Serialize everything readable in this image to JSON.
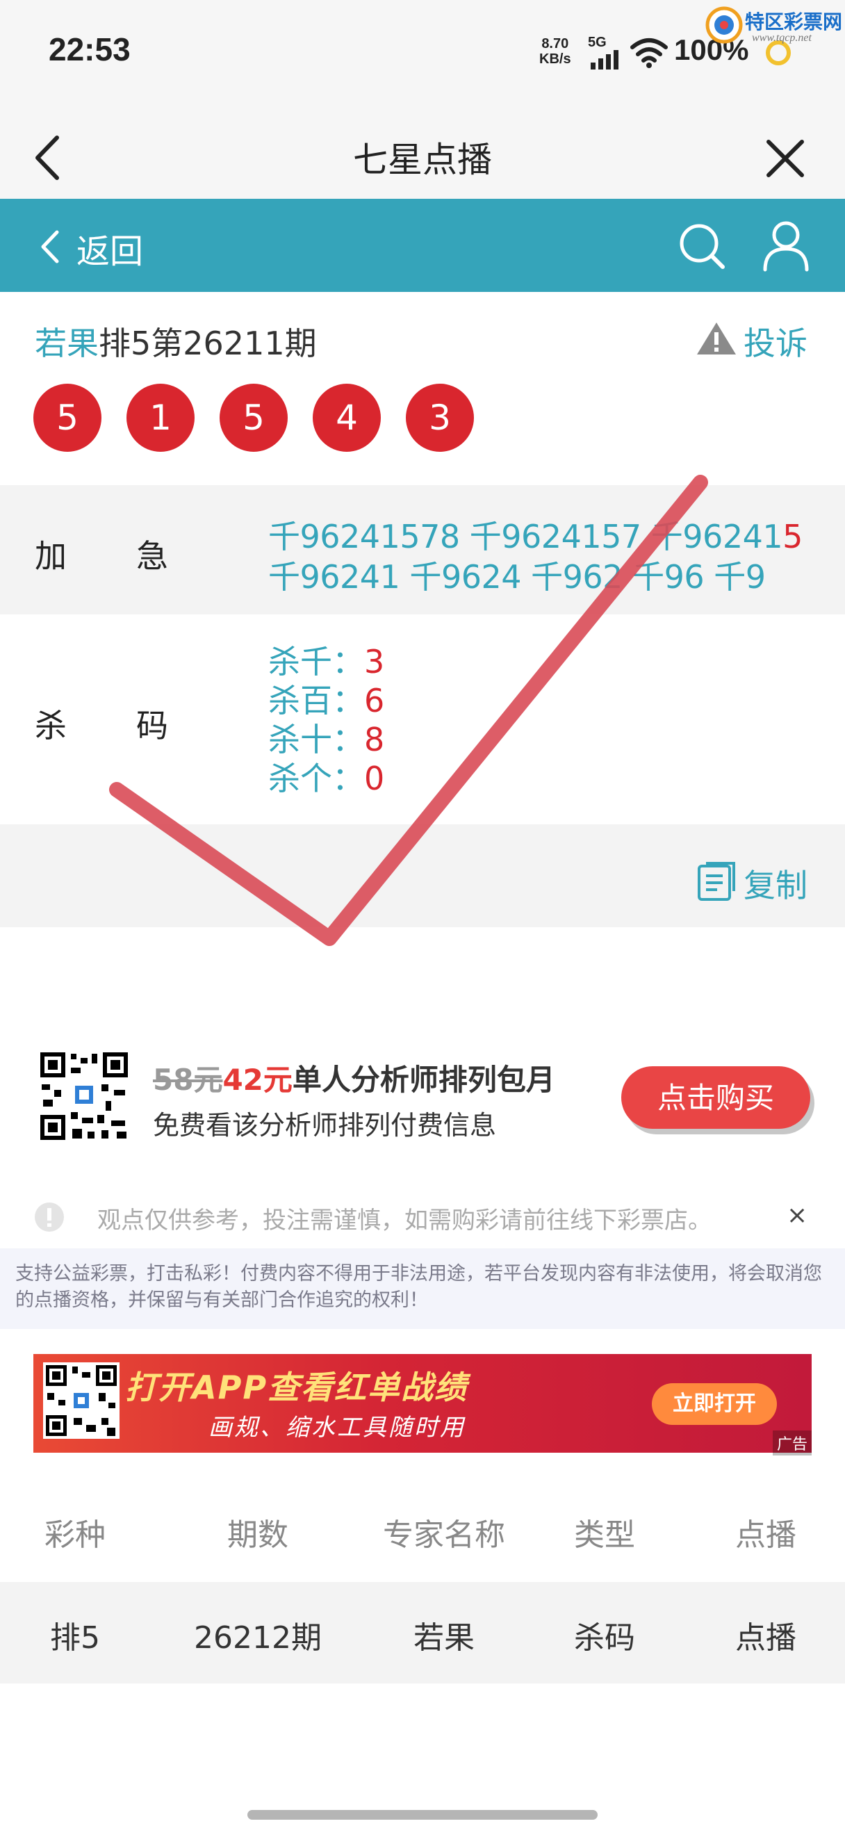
{
  "status": {
    "time": "22:53",
    "net_speed_top": "8.70",
    "net_speed_bottom": "KB/s",
    "net_gen": "5G",
    "battery": "100%",
    "watermark_text": "特区彩票网",
    "watermark_url": "www.tqcp.net"
  },
  "header": {
    "title": "七星点播",
    "back_label": "返回"
  },
  "info": {
    "expert_name": "若果",
    "issue_text": "排5第26211期",
    "report_label": "投诉",
    "balls": [
      "5",
      "1",
      "5",
      "4",
      "3"
    ]
  },
  "rows": {
    "combo": {
      "label_a": "加",
      "label_b": "急",
      "line1": [
        {
          "t": "千962415",
          "c": "teal"
        },
        {
          "t": "78",
          "c": "teal"
        },
        {
          "t": " 千962415",
          "c": "teal"
        },
        {
          "t": "7",
          "c": "teal"
        },
        {
          "t": " 千96241",
          "c": "teal"
        },
        {
          "t": "5",
          "c": "red"
        }
      ],
      "line2": "千96241 千9624 千962 千96 千9"
    },
    "kill": {
      "label_a": "杀",
      "label_b": "码",
      "items": [
        {
          "label": "杀千：",
          "value": "3"
        },
        {
          "label": "杀百：",
          "value": "6"
        },
        {
          "label": "杀十：",
          "value": "8"
        },
        {
          "label": "杀个：",
          "value": "0"
        }
      ]
    },
    "copy_label": "复制"
  },
  "promo": {
    "old_price": "58元",
    "new_price": "42元",
    "title_rest": "单人分析师排列包月",
    "subtitle": "免费看该分析师排列付费信息",
    "button": "点击购买"
  },
  "notice": {
    "text": "观点仅供参考，投注需谨慎，如需购彩请前往线下彩票店。",
    "close": "×"
  },
  "legal": "支持公益彩票，打击私彩！付费内容不得用于非法用途，若平台发现内容有非法使用，将会取消您的点播资格，并保留与有关部门合作追究的权利！",
  "ad": {
    "title": "打开APP查看红单战绩",
    "subtitle": "画规、缩水工具随时用",
    "button": "立即打开",
    "tag": "广告"
  },
  "table": {
    "headers": [
      "彩种",
      "期数",
      "专家名称",
      "类型",
      "点播"
    ],
    "row": [
      "排5",
      "26212期",
      "若果",
      "杀码",
      "点播"
    ]
  },
  "colors": {
    "accent": "#35a4ba",
    "ball_red": "#d9262e",
    "check_mark": "#d94b56"
  }
}
